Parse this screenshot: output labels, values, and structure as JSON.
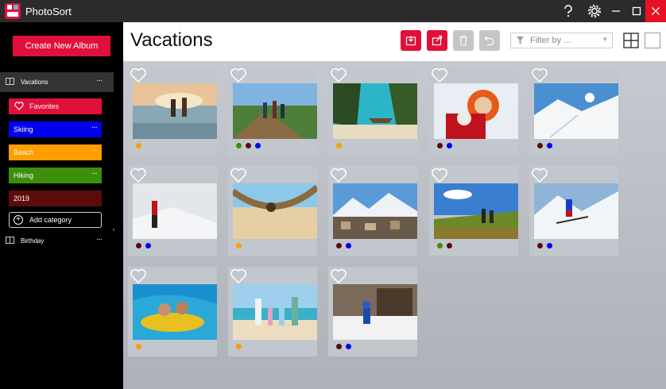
{
  "app": {
    "title": "PhotoSort"
  },
  "sidebar": {
    "create_label": "Create New Album",
    "albums": [
      {
        "label": "Vacations",
        "active": true
      },
      {
        "label": "Birthday",
        "active": false
      }
    ],
    "categories": [
      {
        "label": "Favorites",
        "color": "#e0103a",
        "has_menu": false
      },
      {
        "label": "Skiing",
        "color": "#0000ee",
        "has_menu": true
      },
      {
        "label": "Beach",
        "color": "#ff9d00",
        "has_menu": true
      },
      {
        "label": "Hiking",
        "color": "#3c8f0a",
        "has_menu": true
      },
      {
        "label": "2019",
        "color": "#5b0b0b",
        "has_menu": false
      }
    ],
    "add_category_label": "Add category",
    "menu_glyph": "···"
  },
  "main": {
    "title": "Vacations",
    "filter_placeholder": "Filter by ...",
    "toolbar": [
      "import-icon",
      "export-icon",
      "trash-icon",
      "undo-icon"
    ]
  },
  "colors": {
    "accent": "#e0103a",
    "orange": "#ff9d00",
    "green": "#3c8f0a",
    "maroon": "#5b0b0b",
    "blue": "#0000ee"
  },
  "photos": [
    {
      "subject": "couple running in sea at sunset",
      "tags": [
        "orange"
      ]
    },
    {
      "subject": "hikers on mountain trail",
      "tags": [
        "green",
        "maroon",
        "blue"
      ]
    },
    {
      "subject": "longtail boat at tropical beach",
      "tags": [
        "orange"
      ]
    },
    {
      "subject": "woman with dog in snow",
      "tags": [
        "maroon",
        "blue"
      ]
    },
    {
      "subject": "snowy mountain with ski tracks",
      "tags": [
        "maroon",
        "blue"
      ]
    },
    {
      "subject": "person in red jacket in snowstorm",
      "tags": [
        "maroon",
        "blue"
      ]
    },
    {
      "subject": "woman in hammock on beach",
      "tags": [
        "orange"
      ]
    },
    {
      "subject": "mountain village in winter",
      "tags": [
        "maroon",
        "blue"
      ]
    },
    {
      "subject": "hikers on grassy hill",
      "tags": [
        "green",
        "maroon"
      ]
    },
    {
      "subject": "skier on slope",
      "tags": [
        "maroon",
        "blue"
      ]
    },
    {
      "subject": "couple on inflatable in waves",
      "tags": [
        "orange"
      ]
    },
    {
      "subject": "family walking on beach",
      "tags": [
        "orange"
      ]
    },
    {
      "subject": "child in snow by cabin",
      "tags": [
        "maroon",
        "blue"
      ]
    }
  ]
}
